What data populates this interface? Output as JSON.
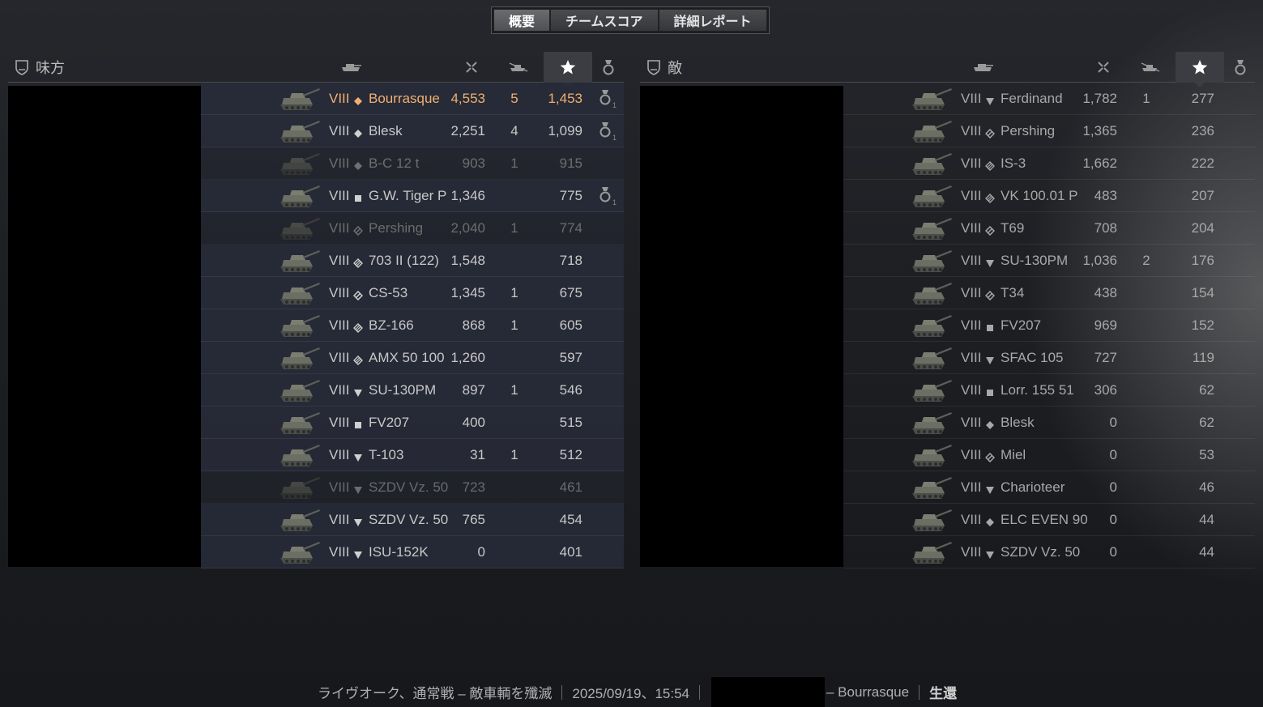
{
  "tabs": [
    {
      "label": "概要",
      "active": true
    },
    {
      "label": "チームスコア",
      "active": false
    },
    {
      "label": "詳細レポート",
      "active": false
    }
  ],
  "ally": {
    "team_label": "味方",
    "rows": [
      {
        "tier": "VIII",
        "cls": "lt",
        "tank": "Bourrasque",
        "dmg": "4,553",
        "kills": "5",
        "xp": "1,453",
        "medal": true,
        "self": true,
        "dim": false
      },
      {
        "tier": "VIII",
        "cls": "lt",
        "tank": "Blesk",
        "dmg": "2,251",
        "kills": "4",
        "xp": "1,099",
        "medal": true,
        "self": false,
        "dim": false
      },
      {
        "tier": "VIII",
        "cls": "lt",
        "tank": "B-C 12 t",
        "dmg": "903",
        "kills": "1",
        "xp": "915",
        "medal": false,
        "self": false,
        "dim": true
      },
      {
        "tier": "VIII",
        "cls": "spg",
        "tank": "G.W. Tiger P",
        "dmg": "1,346",
        "kills": "",
        "xp": "775",
        "medal": true,
        "self": false,
        "dim": false
      },
      {
        "tier": "VIII",
        "cls": "mt",
        "tank": "Pershing",
        "dmg": "2,040",
        "kills": "1",
        "xp": "774",
        "medal": false,
        "self": false,
        "dim": true
      },
      {
        "tier": "VIII",
        "cls": "ht",
        "tank": "703 II (122)",
        "dmg": "1,548",
        "kills": "",
        "xp": "718",
        "medal": false,
        "self": false,
        "dim": false
      },
      {
        "tier": "VIII",
        "cls": "mt",
        "tank": "CS-53",
        "dmg": "1,345",
        "kills": "1",
        "xp": "675",
        "medal": false,
        "self": false,
        "dim": false
      },
      {
        "tier": "VIII",
        "cls": "ht",
        "tank": "BZ-166",
        "dmg": "868",
        "kills": "1",
        "xp": "605",
        "medal": false,
        "self": false,
        "dim": false
      },
      {
        "tier": "VIII",
        "cls": "ht",
        "tank": "AMX 50 100",
        "dmg": "1,260",
        "kills": "",
        "xp": "597",
        "medal": false,
        "self": false,
        "dim": false
      },
      {
        "tier": "VIII",
        "cls": "td",
        "tank": "SU-130PM",
        "dmg": "897",
        "kills": "1",
        "xp": "546",
        "medal": false,
        "self": false,
        "dim": false
      },
      {
        "tier": "VIII",
        "cls": "spg",
        "tank": "FV207",
        "dmg": "400",
        "kills": "",
        "xp": "515",
        "medal": false,
        "self": false,
        "dim": false
      },
      {
        "tier": "VIII",
        "cls": "td",
        "tank": "T-103",
        "dmg": "31",
        "kills": "1",
        "xp": "512",
        "medal": false,
        "self": false,
        "dim": false
      },
      {
        "tier": "VIII",
        "cls": "td",
        "tank": "SZDV Vz. 50",
        "dmg": "723",
        "kills": "",
        "xp": "461",
        "medal": false,
        "self": false,
        "dim": true
      },
      {
        "tier": "VIII",
        "cls": "td",
        "tank": "SZDV Vz. 50",
        "dmg": "765",
        "kills": "",
        "xp": "454",
        "medal": false,
        "self": false,
        "dim": false
      },
      {
        "tier": "VIII",
        "cls": "td",
        "tank": "ISU-152K",
        "dmg": "0",
        "kills": "",
        "xp": "401",
        "medal": false,
        "self": false,
        "dim": false
      }
    ]
  },
  "enemy": {
    "team_label": "敵",
    "rows": [
      {
        "tier": "VIII",
        "cls": "td",
        "tank": "Ferdinand",
        "dmg": "1,782",
        "kills": "1",
        "xp": "277"
      },
      {
        "tier": "VIII",
        "cls": "mt",
        "tank": "Pershing",
        "dmg": "1,365",
        "kills": "",
        "xp": "236"
      },
      {
        "tier": "VIII",
        "cls": "ht",
        "tank": "IS-3",
        "dmg": "1,662",
        "kills": "",
        "xp": "222"
      },
      {
        "tier": "VIII",
        "cls": "ht",
        "tank": "VK 100.01 P",
        "dmg": "483",
        "kills": "",
        "xp": "207"
      },
      {
        "tier": "VIII",
        "cls": "mt",
        "tank": "T69",
        "dmg": "708",
        "kills": "",
        "xp": "204"
      },
      {
        "tier": "VIII",
        "cls": "td",
        "tank": "SU-130PM",
        "dmg": "1,036",
        "kills": "2",
        "xp": "176"
      },
      {
        "tier": "VIII",
        "cls": "mt",
        "tank": "T34",
        "dmg": "438",
        "kills": "",
        "xp": "154"
      },
      {
        "tier": "VIII",
        "cls": "spg",
        "tank": "FV207",
        "dmg": "969",
        "kills": "",
        "xp": "152"
      },
      {
        "tier": "VIII",
        "cls": "td",
        "tank": "SFAC 105",
        "dmg": "727",
        "kills": "",
        "xp": "119"
      },
      {
        "tier": "VIII",
        "cls": "spg",
        "tank": "Lorr. 155 51",
        "dmg": "306",
        "kills": "",
        "xp": "62"
      },
      {
        "tier": "VIII",
        "cls": "lt",
        "tank": "Blesk",
        "dmg": "0",
        "kills": "",
        "xp": "62"
      },
      {
        "tier": "VIII",
        "cls": "mt",
        "tank": "Miel",
        "dmg": "0",
        "kills": "",
        "xp": "53"
      },
      {
        "tier": "VIII",
        "cls": "td",
        "tank": "Charioteer",
        "dmg": "0",
        "kills": "",
        "xp": "46"
      },
      {
        "tier": "VIII",
        "cls": "lt",
        "tank": "ELC EVEN 90",
        "dmg": "0",
        "kills": "",
        "xp": "44"
      },
      {
        "tier": "VIII",
        "cls": "td",
        "tank": "SZDV Vz. 50",
        "dmg": "0",
        "kills": "",
        "xp": "44"
      }
    ]
  },
  "medal_count": "1",
  "footer": {
    "map_mode": "ライヴオーク、通常戦 – 敵車輌を殲滅",
    "datetime": "2025/09/19、15:54",
    "vehicle": "– Bourrasque",
    "status": "生還"
  },
  "colors": {
    "self_highlight": "#f0b070",
    "accent_bg": "#3b3d42"
  }
}
